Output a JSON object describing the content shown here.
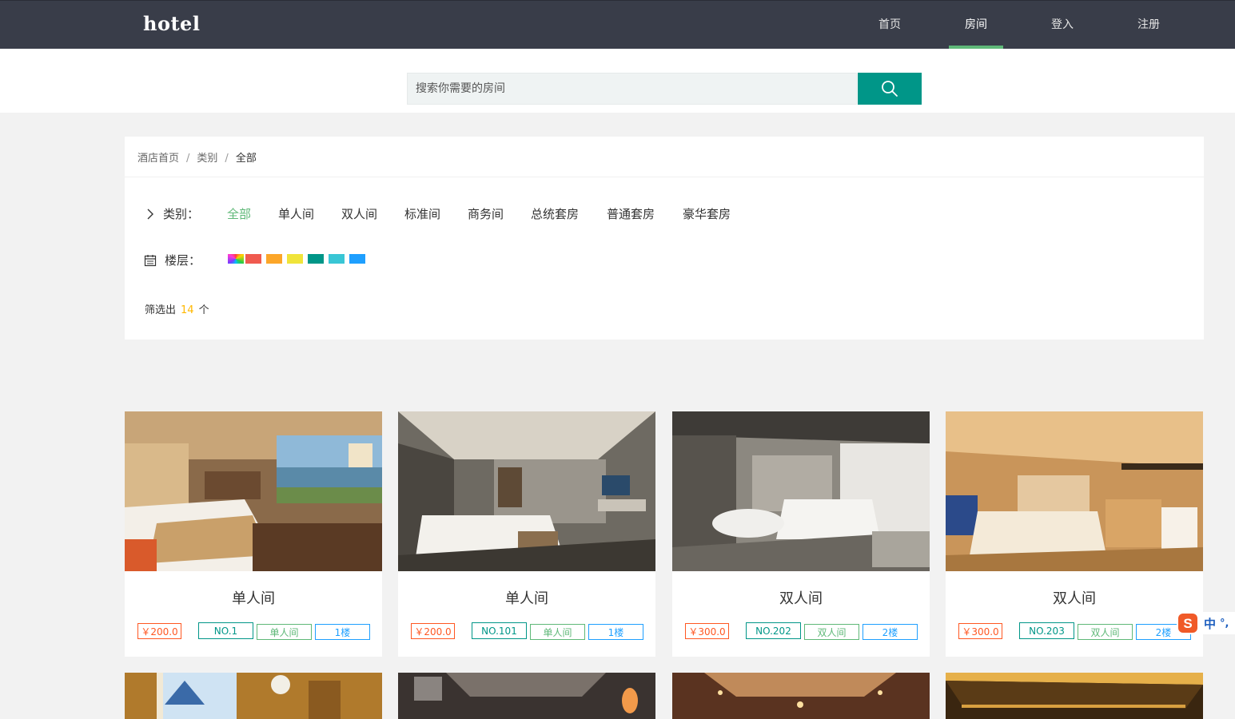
{
  "header": {
    "logo": "hotel",
    "nav": [
      {
        "label": "首页",
        "active": false
      },
      {
        "label": "房间",
        "active": true
      },
      {
        "label": "登入",
        "active": false
      },
      {
        "label": "注册",
        "active": false
      }
    ]
  },
  "search": {
    "placeholder": "搜索你需要的房间",
    "button_icon": "search-icon"
  },
  "breadcrumb": {
    "items": [
      "酒店首页",
      "类别",
      "全部"
    ],
    "separator": "/"
  },
  "filters": {
    "category_label": "类别：",
    "categories": [
      "全部",
      "单人间",
      "双人间",
      "标准间",
      "商务间",
      "总统套房",
      "普通套房",
      "豪华套房"
    ],
    "active_category": "全部",
    "floor_label": "楼层：",
    "floor_colors": [
      "multicolor",
      "#f05a4f",
      "#fca629",
      "#f0e43a",
      "#009688",
      "#39c6d5",
      "#1e9fff"
    ]
  },
  "result": {
    "prefix": "筛选出",
    "count": "14",
    "suffix": "个"
  },
  "rooms": [
    {
      "name": "单人间",
      "price": "￥200.0",
      "no": "NO.1",
      "type": "单人间",
      "floor": "1楼"
    },
    {
      "name": "单人间",
      "price": "￥200.0",
      "no": "NO.101",
      "type": "单人间",
      "floor": "1楼"
    },
    {
      "name": "双人间",
      "price": "￥300.0",
      "no": "NO.202",
      "type": "双人间",
      "floor": "2楼"
    },
    {
      "name": "双人间",
      "price": "￥300.0",
      "no": "NO.203",
      "type": "双人间",
      "floor": "2楼"
    }
  ],
  "ime": {
    "label": "中",
    "extra": "°,"
  },
  "colors": {
    "header_bg": "#393d49",
    "accent_green": "#5fb878",
    "search_button": "#009688",
    "price": "#ff5722",
    "room_no": "#009688",
    "room_type": "#5fb878",
    "floor": "#1e9fff",
    "count": "#ffb800"
  }
}
